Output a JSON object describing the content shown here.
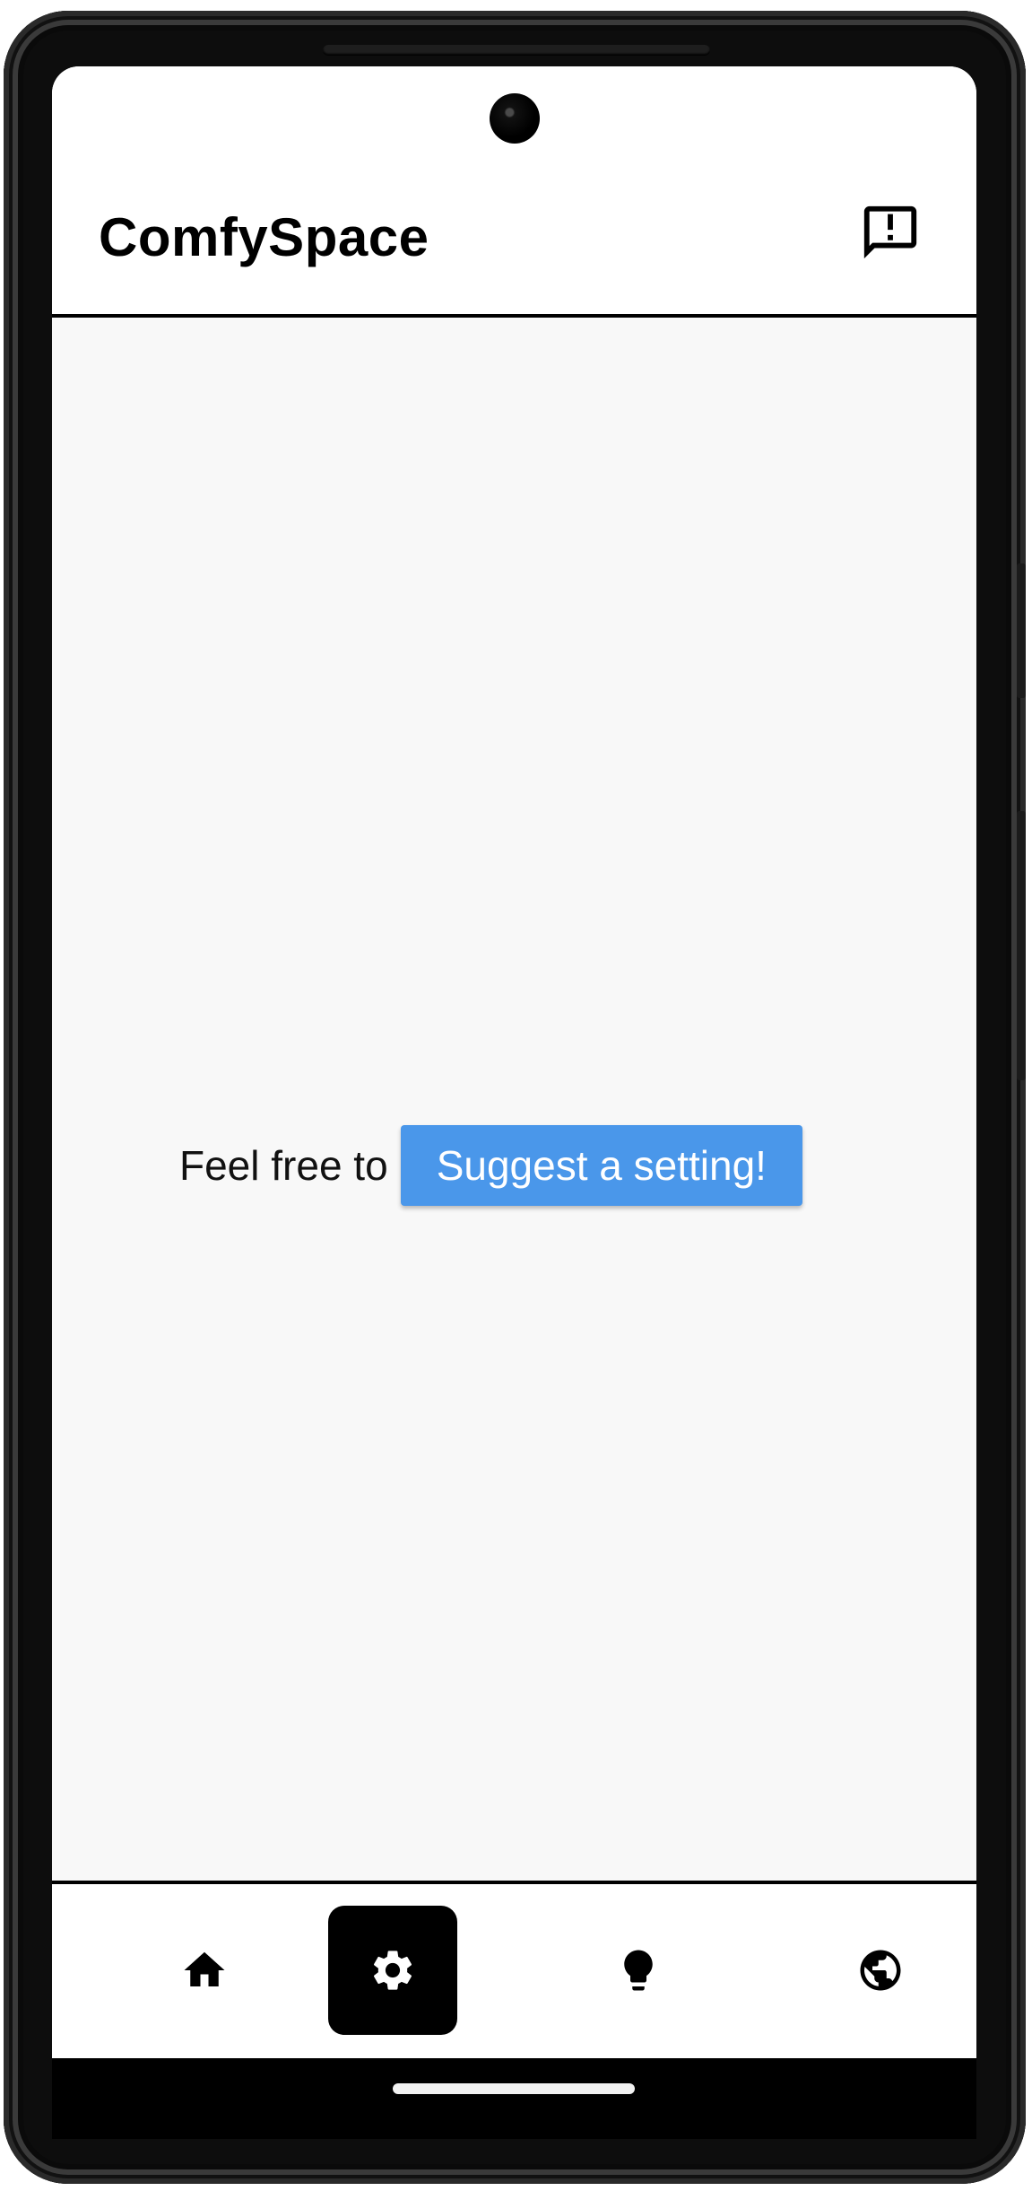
{
  "app": {
    "title": "ComfySpace"
  },
  "header": {
    "feedback_icon": "feedback-icon"
  },
  "main": {
    "prompt_text": "Feel free to",
    "suggest_button_label": "Suggest a setting!"
  },
  "nav": {
    "items": [
      {
        "icon": "home-icon",
        "active": false
      },
      {
        "icon": "gear-icon",
        "active": true
      },
      {
        "icon": "lightbulb-icon",
        "active": false
      },
      {
        "icon": "globe-icon",
        "active": false
      }
    ]
  },
  "colors": {
    "accent": "#4a97ea",
    "content_bg": "#f8f8f8",
    "active_nav_bg": "#000000"
  }
}
